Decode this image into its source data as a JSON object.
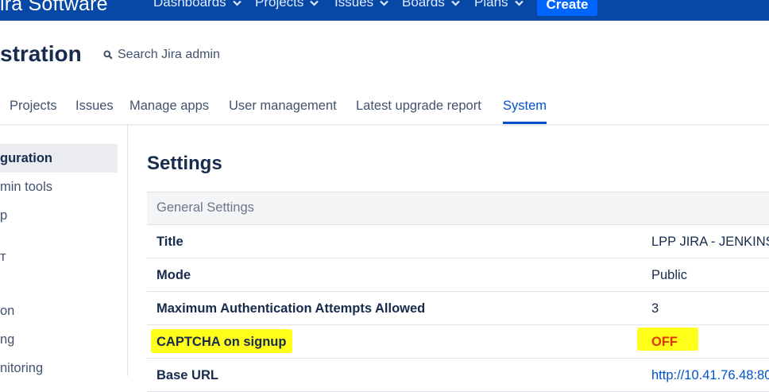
{
  "topnav": {
    "brand": "ira Software",
    "items": [
      {
        "label": "Dashboards"
      },
      {
        "label": "Projects"
      },
      {
        "label": "Issues"
      },
      {
        "label": "Boards"
      },
      {
        "label": "Plans"
      }
    ],
    "create_label": "Create"
  },
  "header": {
    "title": "stration",
    "search_label": "Search Jira admin"
  },
  "tabs": [
    {
      "label": "Projects"
    },
    {
      "label": "Issues"
    },
    {
      "label": "Manage apps"
    },
    {
      "label": "User management"
    },
    {
      "label": "Latest upgrade report"
    },
    {
      "label": "System",
      "active": true
    }
  ],
  "sidebar": {
    "items": [
      {
        "label": "guration",
        "active": true
      },
      {
        "label": "min tools"
      },
      {
        "label": "p"
      },
      {
        "label": "т"
      },
      {
        "label": "on"
      },
      {
        "label": "ng"
      },
      {
        "label": "nitoring"
      }
    ]
  },
  "main": {
    "section_title": "Settings",
    "group_title": "General Settings",
    "rows": [
      {
        "key": "Title",
        "value": "LPP JIRA - JENKINS d"
      },
      {
        "key": "Mode",
        "value": "Public"
      },
      {
        "key": "Maximum Authentication Attempts Allowed",
        "value": "3"
      },
      {
        "key": "CAPTCHA on signup",
        "value": "OFF"
      },
      {
        "key": "Base URL",
        "value": "http://10.41.76.48:80"
      }
    ]
  },
  "colors": {
    "topbar": "#0747a6",
    "create_button": "#0065ff",
    "active_tab": "#0052cc",
    "highlight": "#ffff1a",
    "off_status": "#de350b"
  }
}
